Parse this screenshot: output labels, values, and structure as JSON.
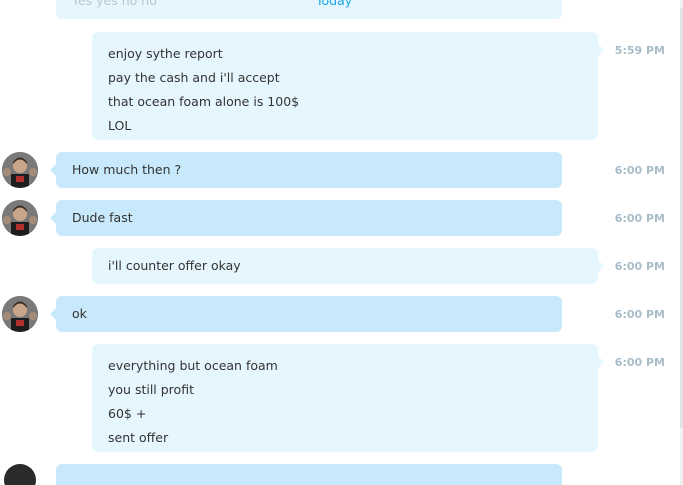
{
  "partial_top": {
    "text": "Yes yes no no",
    "date_label": "Today"
  },
  "messages": [
    {
      "direction": "out",
      "lines": [
        "enjoy sythe report",
        "pay the cash and i'll accept",
        "that ocean foam alone is 100$",
        "LOL"
      ],
      "time": "5:59 PM"
    },
    {
      "direction": "in",
      "lines": [
        "How much then ?"
      ],
      "time": "6:00 PM"
    },
    {
      "direction": "in",
      "lines": [
        "Dude fast"
      ],
      "time": "6:00 PM"
    },
    {
      "direction": "out",
      "lines": [
        "i'll counter offer okay"
      ],
      "time": "6:00 PM"
    },
    {
      "direction": "in",
      "lines": [
        "ok"
      ],
      "time": "6:00 PM"
    },
    {
      "direction": "out",
      "lines": [
        "everything but ocean foam",
        "you still profit",
        "60$ +",
        "sent offer"
      ],
      "time": "6:00 PM"
    }
  ],
  "colors": {
    "incoming_bubble": "#c7e9fb",
    "outgoing_bubble": "#e6f6fe",
    "timestamp": "#a8bcc8",
    "accent": "#19a8e3"
  },
  "icons": {
    "avatar": "contact-avatar"
  }
}
